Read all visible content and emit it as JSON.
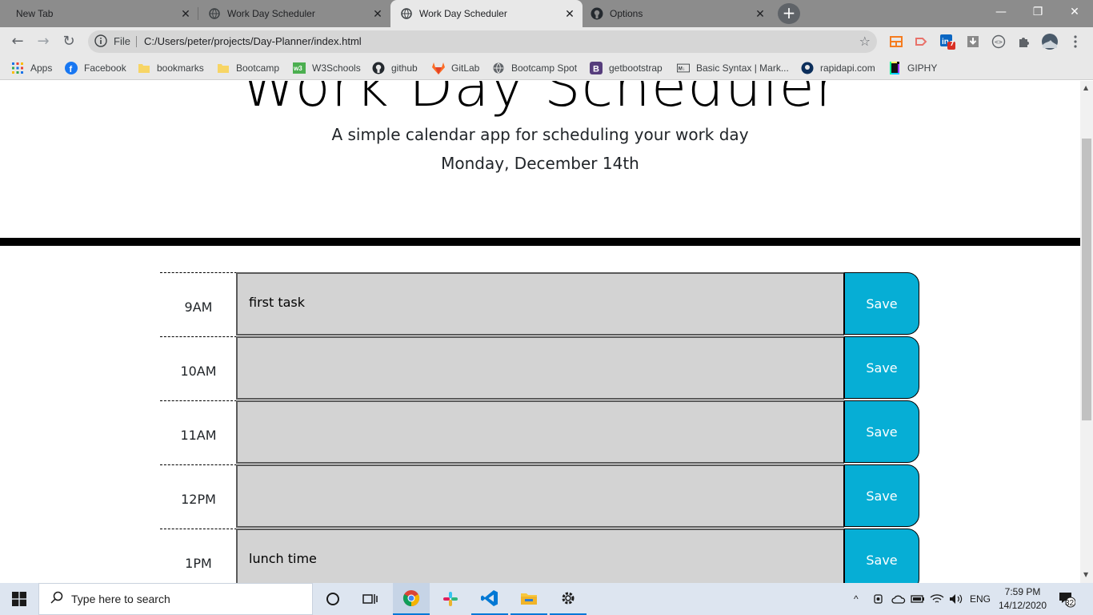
{
  "browser": {
    "tabs": [
      {
        "label": "New Tab",
        "icon": "none"
      },
      {
        "label": "Work Day Scheduler",
        "icon": "globe-icon"
      },
      {
        "label": "Work Day Scheduler",
        "icon": "globe-icon",
        "active": true
      },
      {
        "label": "Options",
        "icon": "github-icon"
      }
    ],
    "new_tab": "+",
    "window_controls": {
      "minimize": "—",
      "restore": "❐",
      "close": "✕"
    },
    "nav": {
      "back": "←",
      "forward": "→",
      "reload": "↻"
    },
    "address": {
      "scheme_label": "File",
      "url": "C:/Users/peter/projects/Day-Planner/index.html",
      "star": "☆"
    },
    "extension_badge": "7",
    "bookmarks": [
      {
        "label": "Apps",
        "icon": "apps-grid-icon"
      },
      {
        "label": "Facebook",
        "icon": "facebook-icon"
      },
      {
        "label": "bookmarks",
        "icon": "folder-icon"
      },
      {
        "label": "Bootcamp",
        "icon": "folder-icon"
      },
      {
        "label": "W3Schools",
        "icon": "w3schools-icon"
      },
      {
        "label": "github",
        "icon": "github-icon"
      },
      {
        "label": "GitLab",
        "icon": "gitlab-icon"
      },
      {
        "label": "Bootcamp Spot",
        "icon": "globe-icon"
      },
      {
        "label": "getbootstrap",
        "icon": "bootstrap-icon"
      },
      {
        "label": "Basic Syntax | Mark...",
        "icon": "markdown-icon"
      },
      {
        "label": "rapidapi.com",
        "icon": "rapidapi-icon"
      },
      {
        "label": "GIPHY",
        "icon": "giphy-icon"
      }
    ]
  },
  "page": {
    "title": "Work Day Scheduler",
    "lead": "A simple calendar app for scheduling your work day",
    "current_day": "Monday, December 14th",
    "accent_color": "#06aed5",
    "past_color": "#d3d3d3",
    "rows": [
      {
        "hour": "9AM",
        "text": "first task",
        "save": "Save"
      },
      {
        "hour": "10AM",
        "text": "",
        "save": "Save"
      },
      {
        "hour": "11AM",
        "text": "",
        "save": "Save"
      },
      {
        "hour": "12PM",
        "text": "",
        "save": "Save"
      },
      {
        "hour": "1PM",
        "text": "lunch time",
        "save": "Save"
      }
    ]
  },
  "taskbar": {
    "search_placeholder": "Type here to search",
    "language": "ENG",
    "time": "7:59 PM",
    "date": "14/12/2020",
    "notifications": "32"
  }
}
